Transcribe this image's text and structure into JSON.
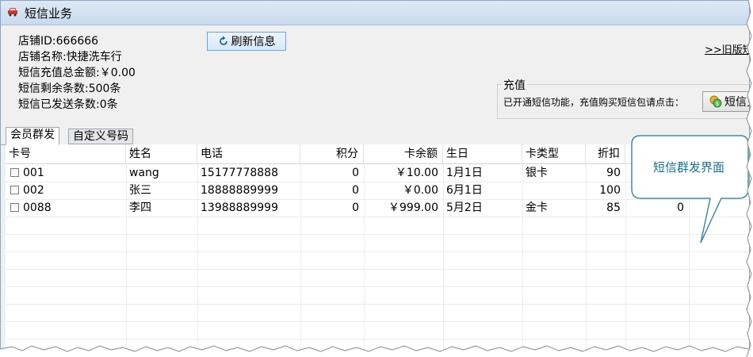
{
  "window": {
    "title": "短信业务"
  },
  "info": {
    "shop_id": "店铺ID:666666",
    "shop_name": "店铺名称:快捷洗车行",
    "recharge_total": "短信充值总金额:￥0.00",
    "remaining": "短信剩余条数:500条",
    "sent": "短信已发送条数:0条"
  },
  "buttons": {
    "refresh": "刷新信息",
    "recharge": "短信充"
  },
  "old_version_link": ">>旧版短",
  "recharge_group": {
    "legend": "充值",
    "text": "已开通短信功能，充值购买短信包请点击："
  },
  "tabs": [
    {
      "label": "会员群发"
    },
    {
      "label": "自定义号码"
    }
  ],
  "table": {
    "columns": [
      "卡号",
      "姓名",
      "电话",
      "积分",
      "卡余额",
      "生日",
      "卡类型",
      "折扣"
    ],
    "rows": [
      {
        "card": "001",
        "name": "wang",
        "phone": "15177778888",
        "points": "0",
        "balance": "￥10.00",
        "birthday": "1月1日",
        "type": "银卡",
        "discount": "90",
        "extra": ""
      },
      {
        "card": "002",
        "name": "张三",
        "phone": "18888889999",
        "points": "0",
        "balance": "￥0.00",
        "birthday": "6月1日",
        "type": "",
        "discount": "100",
        "extra": ""
      },
      {
        "card": "0088",
        "name": "李四",
        "phone": "13988889999",
        "points": "0",
        "balance": "￥999.00",
        "birthday": "5月2日",
        "type": "金卡",
        "discount": "85",
        "extra": "0"
      }
    ]
  },
  "callout": {
    "text": "短信群发界面"
  },
  "colors": {
    "titlebar": "#c9daee",
    "callout_border": "#4a8a9b",
    "callout_text": "#1a6e85"
  }
}
